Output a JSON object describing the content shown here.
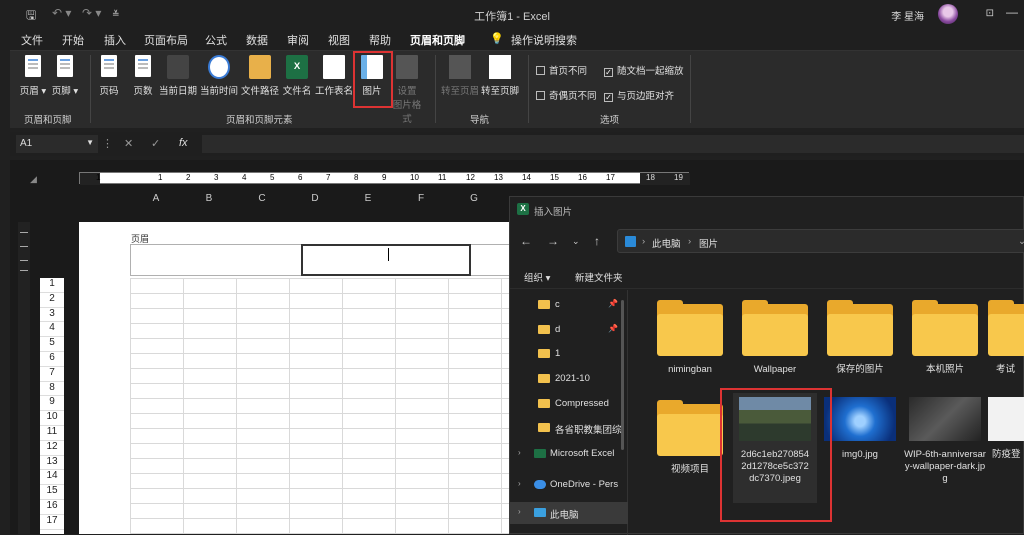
{
  "window": {
    "title": "工作簿1  -  Excel",
    "user": "李 星海"
  },
  "menu_tabs": [
    "文件",
    "开始",
    "插入",
    "页面布局",
    "公式",
    "数据",
    "审阅",
    "视图",
    "帮助",
    "页眉和页脚",
    "操作说明搜索"
  ],
  "ribbon": {
    "buttons": {
      "header": "页眉",
      "footer": "页脚",
      "page_number": "页码",
      "page_count": "页数",
      "current_date": "当前日期",
      "current_time": "当前时间",
      "file_path": "文件路径",
      "file_name": "文件名",
      "sheet_name": "工作表名",
      "picture": "图片",
      "format_picture_1": "设置",
      "format_picture_2": "图片格式",
      "goto_header": "转至页眉",
      "goto_footer": "转至页脚"
    },
    "groups": {
      "hf": "页眉和页脚",
      "elements": "页眉和页脚元素",
      "nav": "导航",
      "options": "选项"
    },
    "options": {
      "different_first": {
        "label": "首页不同",
        "checked": false
      },
      "different_odd_even": {
        "label": "奇偶页不同",
        "checked": false
      },
      "scale_with_doc": {
        "label": "随文档一起缩放",
        "checked": true
      },
      "align_margins": {
        "label": "与页边距对齐",
        "checked": true
      }
    }
  },
  "formula_bar": {
    "name_box": "A1",
    "fx": "fx"
  },
  "ruler_numbers": [
    "1",
    "1",
    "2",
    "3",
    "4",
    "5",
    "6",
    "7",
    "8",
    "9",
    "10",
    "11",
    "12",
    "13",
    "14",
    "15",
    "16",
    "17",
    "18",
    "19"
  ],
  "columns": [
    "A",
    "B",
    "C",
    "D",
    "E",
    "F",
    "G"
  ],
  "rows": [
    "1",
    "2",
    "3",
    "4",
    "5",
    "6",
    "7",
    "8",
    "9",
    "10",
    "11",
    "12",
    "13",
    "14",
    "15",
    "16",
    "17"
  ],
  "page": {
    "header_label": "页眉"
  },
  "dialog": {
    "title": "插入图片",
    "breadcrumb": [
      "此电脑",
      "图片"
    ],
    "organize": "组织 ▾",
    "new_folder": "新建文件夹",
    "nav_items": [
      {
        "label": "c",
        "pinned": true
      },
      {
        "label": "d",
        "pinned": true
      },
      {
        "label": "1",
        "pinned": false
      },
      {
        "label": "2021-10",
        "pinned": false
      },
      {
        "label": "Compressed",
        "pinned": false
      },
      {
        "label": "各省职教集团综",
        "pinned": false
      },
      {
        "label": "Microsoft Excel",
        "pinned": false
      },
      {
        "label": "OneDrive - Pers",
        "pinned": false
      },
      {
        "label": "此电脑",
        "pinned": false
      }
    ],
    "folders": [
      "nimingban",
      "Wallpaper",
      "保存的图片",
      "本机照片",
      "考试"
    ],
    "files": [
      {
        "name": "视频项目",
        "kind": "folder"
      },
      {
        "name": "2d6c1eb2708542d1278ce5c372dc7370.jpeg",
        "kind": "landscape"
      },
      {
        "name": "img0.jpg",
        "kind": "windows"
      },
      {
        "name": "WIP-6th-anniversary-wallpaper-dark.jpg",
        "kind": "device"
      },
      {
        "name": "防疫登",
        "kind": "document"
      }
    ]
  }
}
